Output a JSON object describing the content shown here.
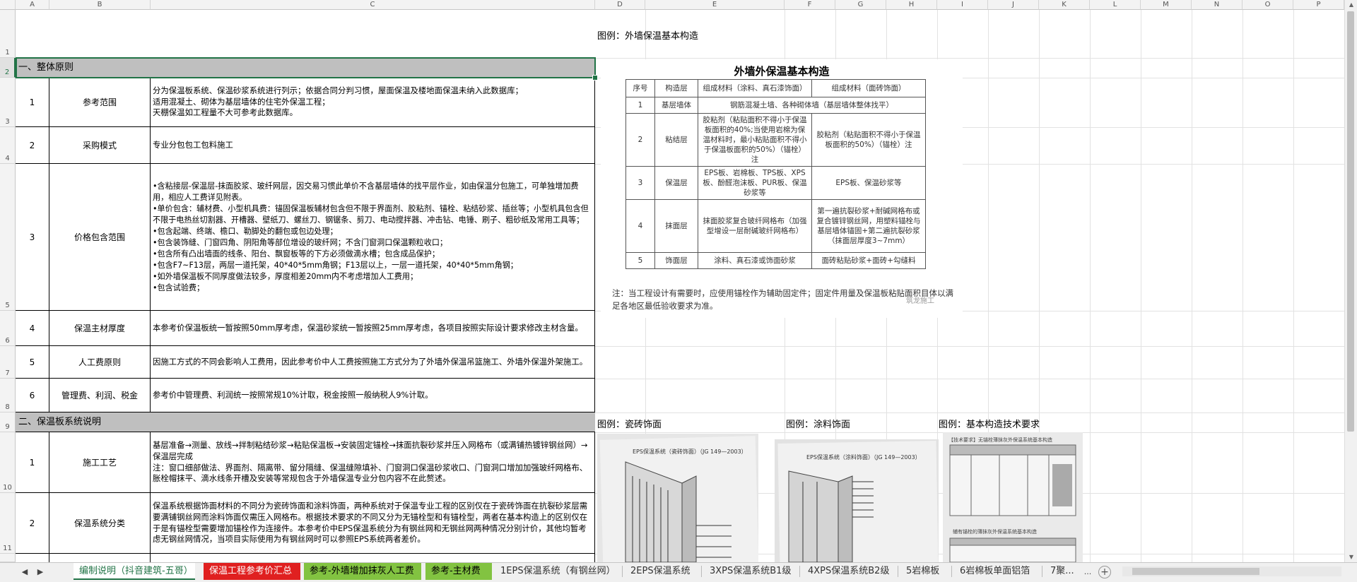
{
  "columns": [
    "A",
    "B",
    "C",
    "D",
    "E",
    "F",
    "G",
    "H",
    "I",
    "J",
    "K",
    "L",
    "M",
    "N",
    "O",
    "P"
  ],
  "rows": [
    "1",
    "2",
    "3",
    "4",
    "5",
    "6",
    "7",
    "8",
    "9",
    "10",
    "11"
  ],
  "section1_title": "一、整体原则",
  "section2_title": "二、保温板系统说明",
  "items": [
    {
      "no": "1",
      "name": "参考范围",
      "content": "分为保温板系统、保温砂浆系统进行列示；依据合同分判习惯，屋面保温及楼地面保温未纳入此数据库；\n适用混凝土、砌体为基层墙体的住宅外保温工程；\n天棚保温如工程量不大可参考此数据库。"
    },
    {
      "no": "2",
      "name": "采购模式",
      "content": "专业分包包工包料施工"
    },
    {
      "no": "3",
      "name": "价格包含范围",
      "content": "•含粘接层-保温层-抹面胶浆、玻纤网层，因交易习惯此单价不含基层墙体的找平层作业，如由保温分包施工，可单独增加费用，相应人工费详见附表。\n•单价包含：辅材费、小型机具费：锚固保温板辅材包含但不限于界面剂、胶粘剂、锚栓、粘结砂浆、插丝等；小型机具包含但不限于电热丝切割器、开槽器、壁纸刀、螺丝刀、钢锯条、剪刀、电动搅拌器、冲击钻、电锤、刷子、粗砂纸及常用工具等；\n•包含起端、终端、檐口、勒脚处的翻包或包边处理；\n•包含装饰缝、门窗四角、阴阳角等部位增设的玻纤网；不含门窗洞口保温颗粒收口；\n•包含所有凸出墙面的线条、阳台、飘窗板等的下方必须做滴水槽；包含成品保护；\n•包含F7~F13层，两层一道托架，40*40*5mm角钢；F13层以上，一层一道托架，40*40*5mm角钢；\n•如外墙保温板不同厚度做法较多，厚度相差20mm内不考虑增加人工费用；\n•包含试验费；"
    },
    {
      "no": "4",
      "name": "保温主材厚度",
      "content": "本参考价保温板统一暂按照50mm厚考虑，保温砂浆统一暂按照25mm厚考虑，各项目按照实际设计要求修改主材含量。"
    },
    {
      "no": "5",
      "name": "人工费原则",
      "content": "因施工方式的不同会影响人工费用，因此参考价中人工费按照施工方式分为了外墙外保温吊篮施工、外墙外保温外架施工。"
    },
    {
      "no": "6",
      "name": "管理费、利润、税金",
      "content": "参考价中管理费、利润统一按照常规10%计取，税金按照一般纳税人9%计取。"
    }
  ],
  "items2": [
    {
      "no": "1",
      "name": "施工工艺",
      "content": "基层准备→测量、放线→拌制粘结砂浆→粘贴保温板→安装固定锚栓→抹面抗裂砂浆并压入网格布（或满铺热镀锌钢丝网）→保温层完成\n注：窗口细部做法、界面剂、隔离带、留分隔缝、保温缝隙填补、门窗洞口保温砂浆收口、门窗洞口增加加强玻纤网格布、胀栓帽抹平、滴水线条开槽及安装等常规包含于外墙保温专业分包内容不在此赘述。"
    },
    {
      "no": "2",
      "name": "保温系统分类",
      "content": "保温系统根据饰面材料的不同分为瓷砖饰面和涂料饰面，两种系统对于保温专业工程的区别仅在于瓷砖饰面在抗裂砂浆层需要满铺钢丝网而涂料饰面仅需压入网格布。根据技术要求的不同又分为无锚栓型和有锚栓型，两者在基本构造上的区别仅在于是有锚栓型需要增加锚栓作为连接件。本参考价中EPS保温系统分为有钢丝网和无钢丝网两种情况分别计价，其他均暂考虑无钢丝网情况，当项目实际使用为有钢丝网时可以参照EPS系统两者差价。"
    }
  ],
  "legend_main": "图例：外墙保温基本构造",
  "legend_tile": "图例：瓷砖饰面",
  "legend_paint": "图例：涂料饰面",
  "legend_tech": "图例：基本构造技术要求",
  "struct": {
    "title": "外墙外保温基本构造",
    "headers": [
      "序号",
      "构造层",
      "组成材料（涂料、真石漆饰面）",
      "组成材料（面砖饰面）"
    ],
    "rows": [
      [
        "1",
        "基层墙体",
        "钢筋混凝土墙、各种砌体墙（基层墙体整体找平）",
        ""
      ],
      [
        "2",
        "粘结层",
        "胶粘剂（粘贴面积不得小于保温板面积的40%;当使用岩棉为保温材料时，最小粘贴面积不得小于保温板面积的50%）（锚栓）注",
        "胶粘剂（粘贴面积不得小于保温板面积的50%）（锚栓）注"
      ],
      [
        "3",
        "保温层",
        "EPS板、岩棉板、TPS板、XPS板、酚醛泡沫板、PUR板、保温砂浆等",
        "EPS板、保温砂浆等"
      ],
      [
        "4",
        "抹面层",
        "抹面胶浆复合玻纤网格布（加强型增设一层耐碱玻纤网格布）",
        "第一遍抗裂砂浆+耐碱网格布或复合镀锌钢丝网，用塑料锚栓与基层墙体锚固+第二遍抗裂砂浆（抹面层厚度3~7mm）"
      ],
      [
        "5",
        "饰面层",
        "涂料、真石漆或饰面砂浆",
        "面砖粘贴砂浆+面砖+勾缝料"
      ]
    ],
    "note": "注：当工程设计有需要时，应使用锚栓作为辅助固定件；固定件用量及保温板粘贴面积目体以满足各地区最低验收要求为准。",
    "watermark": "筑龙施工"
  },
  "photo_tile_caption": "EPS保温系统（瓷砖饰面）（JG 149—2003）",
  "photo_paint_caption": "EPS保温系统（涂料饰面）（JG 149—2003）",
  "photo_tech_caption": "【技术要求】无锚栓薄抹灰外保温系统基本构造",
  "photo_tech_caption2": "辅有锚栓的薄抹灰外保温系统基本构造",
  "tabs": [
    {
      "label": "编制说明（抖音建筑-五哥）",
      "style": "active"
    },
    {
      "label": "保温工程参考价汇总",
      "style": "red"
    },
    {
      "label": "参考-外墙增加抹灰人工费",
      "style": "green"
    },
    {
      "label": "参考-主材费",
      "style": "green"
    },
    {
      "label": "1EPS保温系统（有钢丝网）",
      "style": "plain"
    },
    {
      "label": "2EPS保温系统",
      "style": "plain"
    },
    {
      "label": "3XPS保温系统B1级",
      "style": "plain"
    },
    {
      "label": "4XPS保温系统B2级",
      "style": "plain"
    },
    {
      "label": "5岩棉板",
      "style": "plain"
    },
    {
      "label": "6岩棉板单面铝箔",
      "style": "plain"
    },
    {
      "label": "7聚...",
      "style": "plain"
    }
  ],
  "tab_more": "...",
  "add_sheet": "+",
  "nav_prev": "◀",
  "nav_next": "▶"
}
